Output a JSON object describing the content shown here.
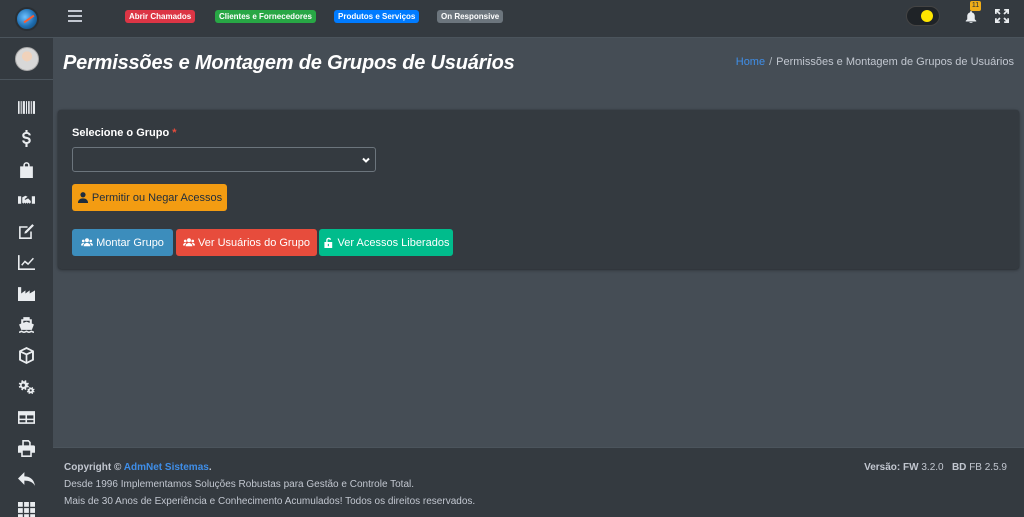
{
  "navbar": {
    "badges": [
      {
        "label": "Abrir Chamados",
        "color": "#dc3545"
      },
      {
        "label": "Clientes e Fornecedores",
        "color": "#28a745"
      },
      {
        "label": "Produtos e Serviços",
        "color": "#007bff"
      },
      {
        "label": "On Responsive",
        "color": "#6c757d"
      }
    ],
    "notification_count": "11"
  },
  "sidebar": {
    "icons": [
      "barcode-icon",
      "dollar-icon",
      "shopping-bag-icon",
      "handshake-icon",
      "edit-icon",
      "chart-line-icon",
      "industry-icon",
      "ship-icon",
      "box-icon",
      "cogs-icon",
      "table-icon",
      "print-icon",
      "undo-icon",
      "grid-icon"
    ]
  },
  "header": {
    "title": "Permissões e Montagem de Grupos de Usuários",
    "breadcrumb": {
      "home": "Home",
      "separator": "/",
      "current": "Permissões e Montagem de Grupos de Usuários"
    }
  },
  "form": {
    "group_label": "Selecione o Grupo",
    "required_mark": "*",
    "group_value": ""
  },
  "buttons": {
    "permit": "Permitir ou Negar Acessos",
    "build_group": "Montar Grupo",
    "view_users": "Ver Usuários do Grupo",
    "view_access": "Ver Acessos Liberados"
  },
  "footer": {
    "copyright_prefix": "Copyright ©",
    "company": "AdmNet Sistemas",
    "period": ".",
    "line2": "Desde 1996 Implementamos Soluções Robustas para Gestão e Controle Total.",
    "line3": "Mais de 30 Anos de Experiência e Conhecimento Acumulados! Todos os direitos reservados.",
    "version_label": "Versão:",
    "fw_label": "FW",
    "fw_version": "3.2.0",
    "bd_label": "BD",
    "bd_version": "FB 2.5.9"
  },
  "colors": {
    "accent": "#3f8ee8",
    "warning": "#f39c12",
    "primary": "#3c8dbc",
    "danger": "#e74c3c",
    "success": "#00bc8c"
  }
}
